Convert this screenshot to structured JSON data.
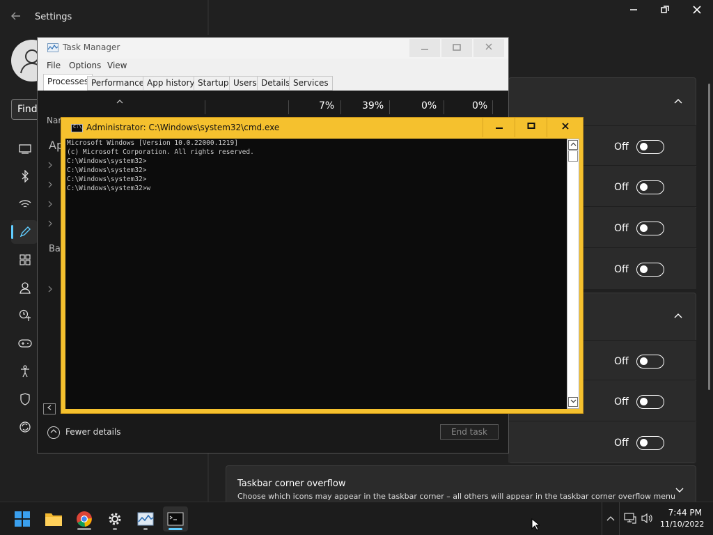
{
  "settings": {
    "title": "Settings",
    "find_text": "Find",
    "toggle_rows": [
      {
        "label": "Off"
      },
      {
        "label": "Off"
      },
      {
        "label": "Off"
      },
      {
        "label": "Off"
      },
      {
        "label": "Off"
      },
      {
        "label": "Off"
      },
      {
        "label": "Off"
      }
    ],
    "overflow": {
      "title": "Taskbar corner overflow",
      "description": "Choose which icons may appear in the taskbar corner – all others will appear in the taskbar corner overflow menu"
    },
    "accent_color": "#60cdff"
  },
  "task_manager": {
    "title": "Task Manager",
    "menu": [
      "File",
      "Options",
      "View"
    ],
    "tabs": [
      "Processes",
      "Performance",
      "App history",
      "Startup",
      "Users",
      "Details",
      "Services"
    ],
    "active_tab": "Processes",
    "header_stats": [
      "7%",
      "39%",
      "0%",
      "0%"
    ],
    "partial_labels": {
      "name_col": "Nar",
      "apps_group": "Ap",
      "background_group": "Ba"
    },
    "fewer_details": "Fewer details",
    "end_task": "End task"
  },
  "cmd": {
    "title": "Administrator: C:\\Windows\\system32\\cmd.exe",
    "icon_text": "C:\\_",
    "border_color": "#f5c12e",
    "lines": [
      "Microsoft Windows [Version 10.0.22000.1219]",
      "(c) Microsoft Corporation. All rights reserved.",
      "C:\\Windows\\system32>",
      "C:\\Windows\\system32>",
      "C:\\Windows\\system32>",
      "C:\\Windows\\system32>w"
    ]
  },
  "taskbar": {
    "apps": [
      "start-icon",
      "file-explorer-icon",
      "chrome-icon",
      "settings-icon",
      "task-manager-icon",
      "terminal-icon"
    ],
    "time": "7:44 PM",
    "date": "11/10/2022"
  }
}
